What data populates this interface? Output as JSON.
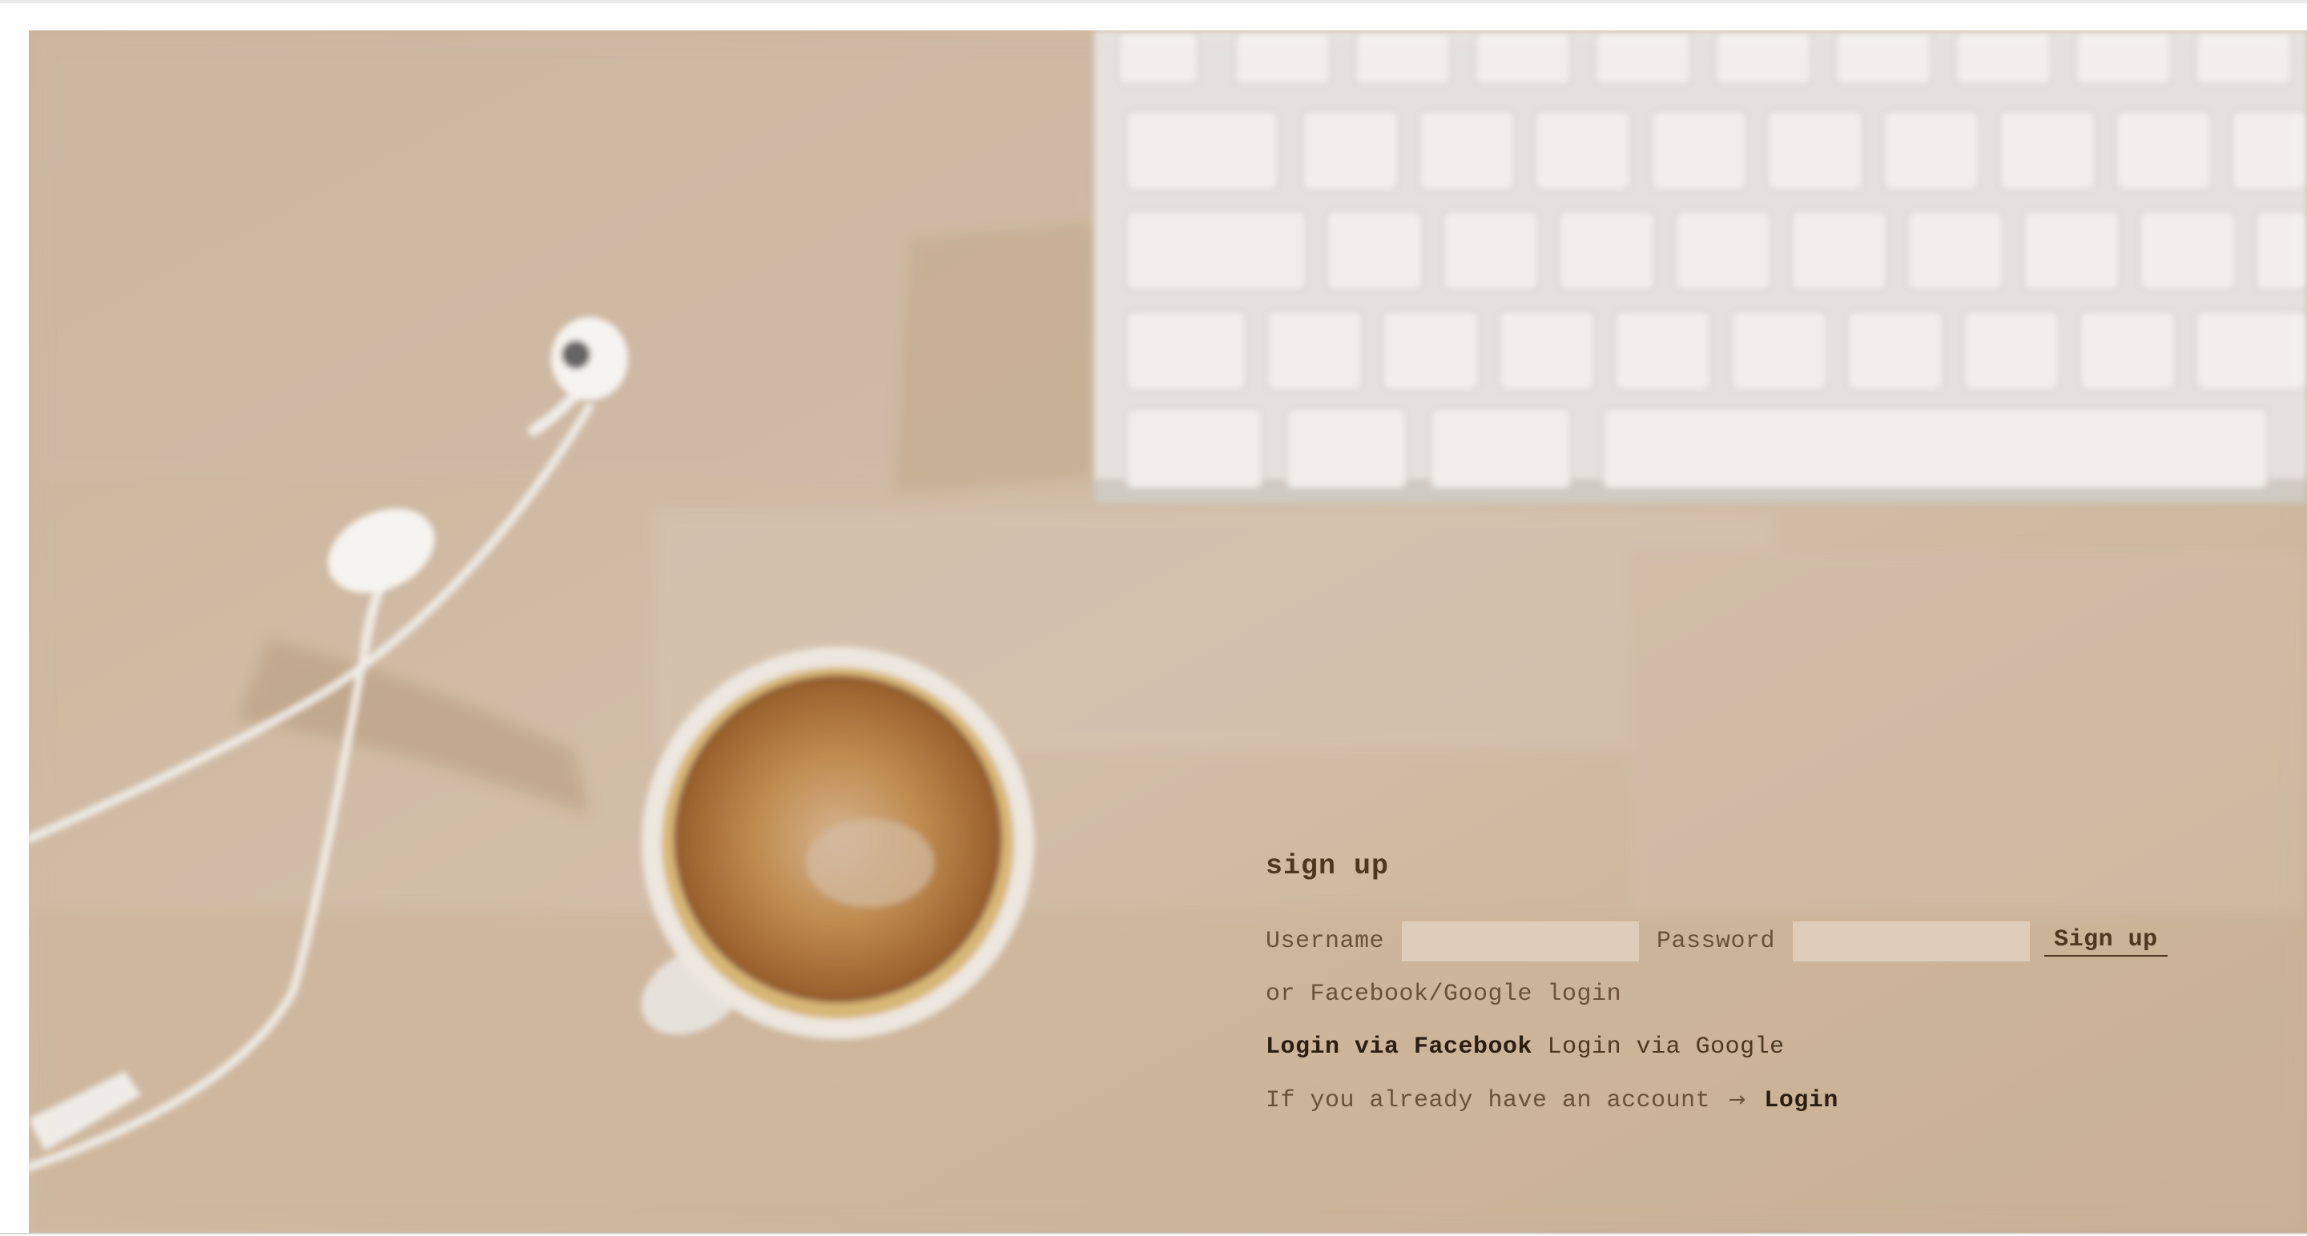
{
  "signup": {
    "title": "sign up",
    "username_label": "Username",
    "username_value": "",
    "username_placeholder": "",
    "password_label": "Password",
    "password_value": "",
    "password_placeholder": "",
    "submit_label": "Sign up"
  },
  "social": {
    "intro": "or Facebook/Google login",
    "facebook_label": "Login via Facebook",
    "google_label": "Login via Google"
  },
  "existing_account": {
    "text": "If you already have an account",
    "arrow": "→",
    "login_label": "Login"
  },
  "colors": {
    "wood": "#c6ad92",
    "text": "#6b5038",
    "heading": "#4e3720",
    "link_strong": "#2c1d0f",
    "input_bg": "#e2d2c1"
  },
  "icons": {
    "arrow": "right-arrow-icon"
  }
}
